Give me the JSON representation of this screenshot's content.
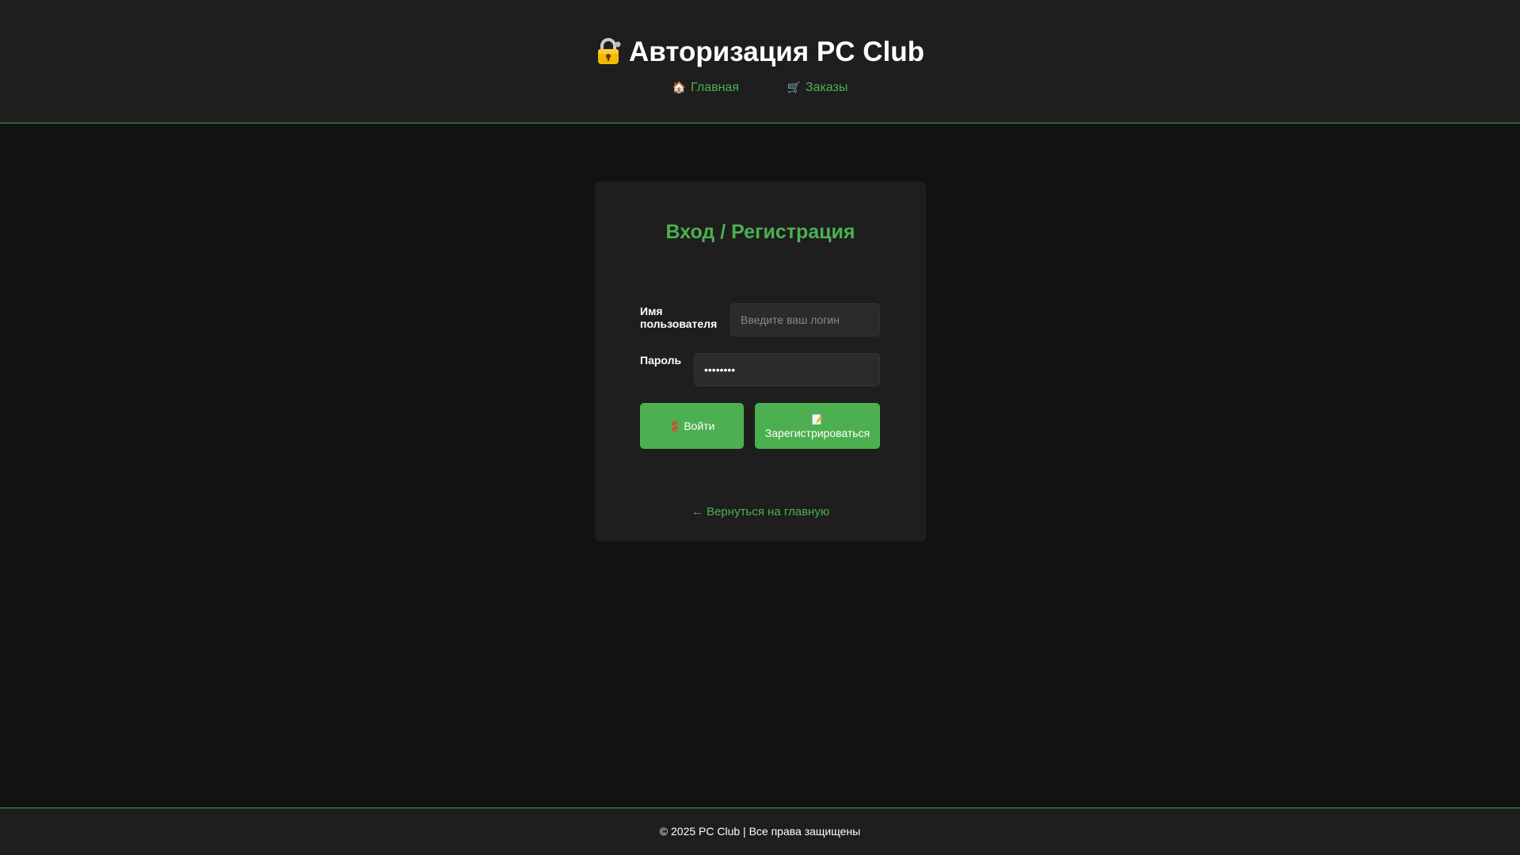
{
  "header": {
    "title": "Авторизация PC Club",
    "title_icon": "lock-icon",
    "nav": [
      {
        "icon": "🏠",
        "icon_name": "home-icon",
        "label": "Главная"
      },
      {
        "icon": "🛒",
        "icon_name": "cart-icon",
        "label": "Заказы"
      }
    ]
  },
  "form": {
    "title": "Вход / Регистрация",
    "username_label": "Имя пользователя",
    "username_placeholder": "Введите ваш логин",
    "username_value": "",
    "password_label": "Пароль",
    "password_value": "••••••••",
    "login_icon": "🚪",
    "login_label": "Войти",
    "register_icon": "📝",
    "register_label": "Зарегистрироваться",
    "back_link": "← Вернуться на главную"
  },
  "footer": {
    "text": "© 2025 PC Club | Все права защищены"
  },
  "colors": {
    "accent": "#4caf50",
    "background": "#121212",
    "panel": "#1e1e1e",
    "input": "#2b2b2b"
  }
}
